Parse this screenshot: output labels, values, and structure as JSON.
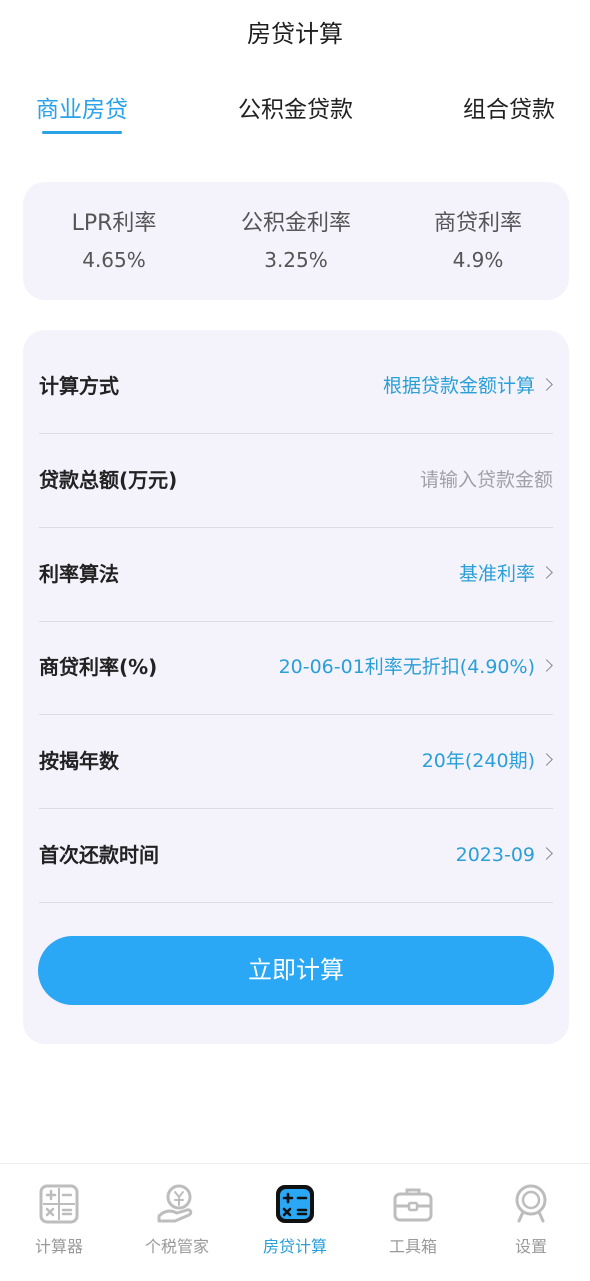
{
  "header": {
    "title": "房贷计算"
  },
  "tabs": [
    {
      "label": "商业房贷",
      "active": true
    },
    {
      "label": "公积金贷款",
      "active": false
    },
    {
      "label": "组合贷款",
      "active": false
    }
  ],
  "rates": [
    {
      "label": "LPR利率",
      "value": "4.65%"
    },
    {
      "label": "公积金利率",
      "value": "3.25%"
    },
    {
      "label": "商贷利率",
      "value": "4.9%"
    }
  ],
  "form": {
    "rows": [
      {
        "label": "计算方式",
        "value": "根据贷款金额计算"
      },
      {
        "label": "贷款总额(万元)",
        "placeholder": "请输入贷款金额"
      },
      {
        "label": "利率算法",
        "value": "基准利率"
      },
      {
        "label": "商贷利率(%)",
        "value": "20-06-01利率无折扣(4.90%)"
      },
      {
        "label": "按揭年数",
        "value": "20年(240期)"
      },
      {
        "label": "首次还款时间",
        "value": "2023-09"
      }
    ],
    "submit_label": "立即计算"
  },
  "bottom_nav": [
    {
      "label": "计算器",
      "icon": "calculator-icon",
      "active": false
    },
    {
      "label": "个税管家",
      "icon": "tax-coin-hand-icon",
      "active": false
    },
    {
      "label": "房贷计算",
      "icon": "mortgage-calculator-icon",
      "active": true
    },
    {
      "label": "工具箱",
      "icon": "toolbox-icon",
      "active": false
    },
    {
      "label": "设置",
      "icon": "settings-icon",
      "active": false
    }
  ],
  "colors": {
    "accent": "#2aa2e8",
    "button": "#2aa7f5",
    "card_bg": "#f4f3fc"
  }
}
